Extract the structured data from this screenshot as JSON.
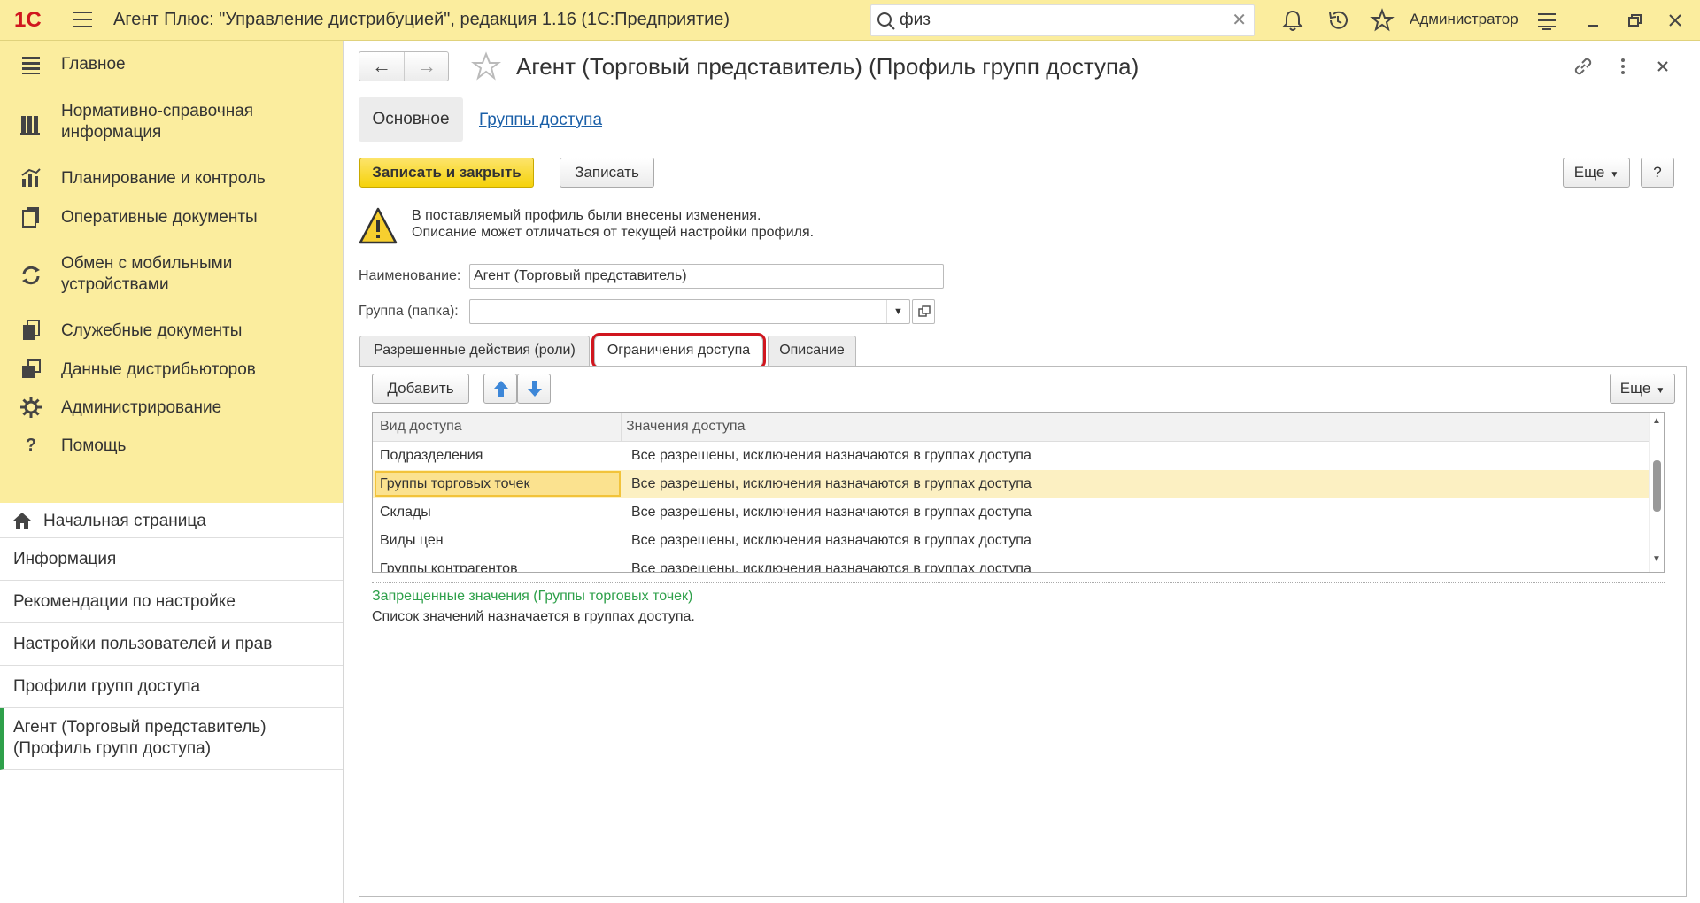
{
  "app": {
    "logo_text": "1С",
    "title": "Агент Плюс: \"Управление дистрибуцией\", редакция 1.16  (1С:Предприятие)",
    "search_value": "физ",
    "user_name": "Администратор"
  },
  "sections": [
    {
      "label": "Главное",
      "icon": "list-icon"
    },
    {
      "label": "Нормативно-справочная информация",
      "icon": "books-icon"
    },
    {
      "label": "Планирование и контроль",
      "icon": "chart-icon"
    },
    {
      "label": "Оперативные документы",
      "icon": "documents-icon"
    },
    {
      "label": "Обмен с мобильными устройствами",
      "icon": "sync-icon"
    },
    {
      "label": "Служебные документы",
      "icon": "service-docs-icon"
    },
    {
      "label": "Данные дистрибьюторов",
      "icon": "distributor-data-icon"
    },
    {
      "label": "Администрирование",
      "icon": "gear-icon"
    },
    {
      "label": "Помощь",
      "icon": "help-icon"
    }
  ],
  "history": [
    {
      "label": "Начальная страница"
    },
    {
      "label": "Информация"
    },
    {
      "label": "Рекомендации по настройке"
    },
    {
      "label": "Настройки пользователей и прав"
    },
    {
      "label": "Профили групп доступа"
    },
    {
      "label": "Агент (Торговый представитель) (Профиль групп доступа)"
    }
  ],
  "form": {
    "title": "Агент (Торговый представитель) (Профиль групп доступа)",
    "tab_main": "Основное",
    "tab_link": "Группы доступа",
    "save_close": "Записать и закрыть",
    "save": "Записать",
    "more": "Еще",
    "help": "?",
    "warning_line1": "В поставляемый профиль были внесены изменения.",
    "warning_line2": "Описание может отличаться от текущей настройки профиля.",
    "name_label": "Наименование:",
    "name_value": "Агент (Торговый представитель)",
    "group_label": "Группа (папка):",
    "group_value": ""
  },
  "inner_tabs": [
    {
      "label": "Разрешенные действия (роли)"
    },
    {
      "label": "Ограничения доступа"
    },
    {
      "label": "Описание"
    }
  ],
  "panel": {
    "add": "Добавить",
    "more": "Еще",
    "columns": [
      "Вид доступа",
      "Значения доступа"
    ],
    "rows": [
      {
        "kind": "Подразделения",
        "value": "Все разрешены, исключения назначаются в группах доступа"
      },
      {
        "kind": "Группы торговых точек",
        "value": "Все разрешены, исключения назначаются в группах доступа"
      },
      {
        "kind": "Склады",
        "value": "Все разрешены, исключения назначаются в группах доступа"
      },
      {
        "kind": "Виды цен",
        "value": "Все разрешены, исключения назначаются в группах доступа"
      },
      {
        "kind": "Группы контрагентов",
        "value": "Все разрешены, исключения назначаются в группах доступа"
      }
    ],
    "restricted_title": "Запрещенные значения (Группы торговых точек)",
    "restricted_info": "Список значений назначается в группах доступа."
  },
  "colors": {
    "accent_yellow": "#fbed9e",
    "logo_red": "#d0161e",
    "link_blue": "#1a5fa8",
    "green": "#2ea04a",
    "selection": "#fcf0c2"
  }
}
